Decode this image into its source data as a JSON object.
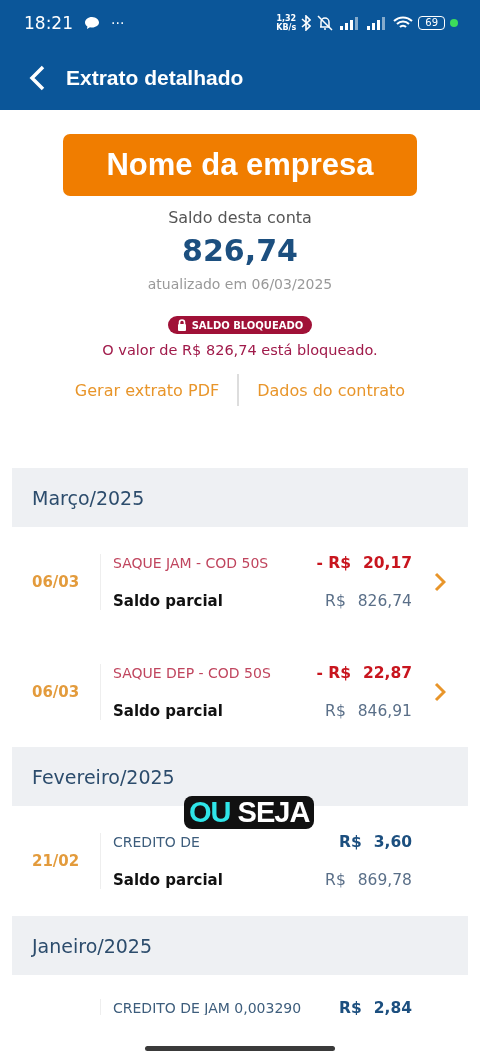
{
  "status_bar": {
    "time": "18:21",
    "more": "···",
    "speed_value": "1,32",
    "speed_unit": "KB/s",
    "battery": "69"
  },
  "header": {
    "title": "Extrato detalhado"
  },
  "company": {
    "name": "Nome da empresa"
  },
  "balance": {
    "label": "Saldo desta conta",
    "amount": "826,74",
    "updated": "atualizado em 06/03/2025"
  },
  "blocked": {
    "badge": "SALDO BLOQUEADO",
    "message": "O valor de R$ 826,74 está bloqueado."
  },
  "links": [
    "Gerar extrato PDF",
    "Dados do contrato"
  ],
  "months": [
    {
      "title": "Março/2025",
      "entries": [
        {
          "date": "06/03",
          "kind": "debit",
          "description": "SAQUE JAM - COD 50S",
          "sign": "- R$",
          "amount": "20,17",
          "partial_label": "Saldo parcial",
          "partial_currency": "R$",
          "partial_amount": "826,74"
        },
        {
          "date": "06/03",
          "kind": "debit",
          "description": "SAQUE DEP - COD 50S",
          "sign": "- R$",
          "amount": "22,87",
          "partial_label": "Saldo parcial",
          "partial_currency": "R$",
          "partial_amount": "846,91"
        }
      ]
    },
    {
      "title": "Fevereiro/2025",
      "entries": [
        {
          "date": "21/02",
          "kind": "credit",
          "description": "CREDITO DE",
          "sign": "R$",
          "amount": "3,60",
          "partial_label": "Saldo parcial",
          "partial_currency": "R$",
          "partial_amount": "869,78"
        }
      ]
    },
    {
      "title": "Janeiro/2025",
      "entries": [
        {
          "kind": "credit",
          "description": "CREDITO DE JAM 0,003290",
          "sign": "R$",
          "amount": "2,84"
        }
      ]
    }
  ],
  "caption": [
    "OU",
    "SEJA"
  ]
}
